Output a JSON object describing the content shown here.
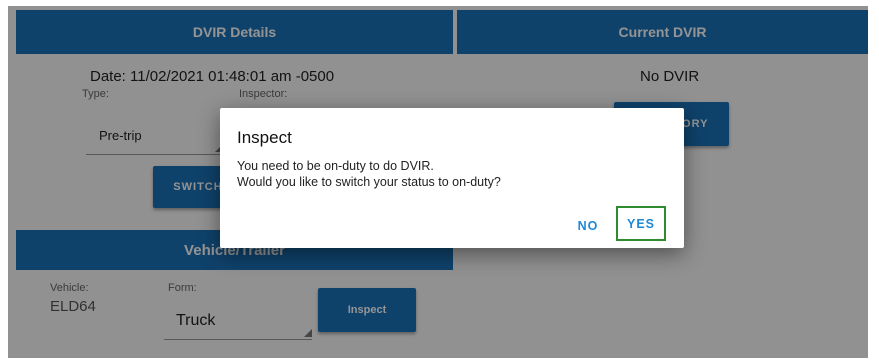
{
  "dvir_details": {
    "header": "DVIR Details",
    "date_line": "Date: 11/02/2021 01:48:01 am -0500",
    "type_label": "Type:",
    "type_value": "Pre-trip",
    "inspector_label": "Inspector:",
    "switch_button": "SWITCH"
  },
  "current_dvir": {
    "header": "Current DVIR",
    "status": "No DVIR",
    "history_button": "TORY"
  },
  "vehicle_trailer": {
    "header": "Vehicle/Trailer",
    "vehicle_label": "Vehicle:",
    "vehicle_value": "ELD64",
    "form_label": "Form:",
    "form_value": "Truck",
    "inspect_button": "Inspect"
  },
  "dialog": {
    "title": "Inspect",
    "message_line1": "You need to be on-duty to do DVIR.",
    "message_line2": "Would you like to switch your status to on-duty?",
    "no_label": "NO",
    "yes_label": "YES"
  },
  "colors": {
    "header_blue": "#1a73b8",
    "dialog_button_text": "#1e88d6",
    "highlight_green": "#2e8b2e"
  }
}
